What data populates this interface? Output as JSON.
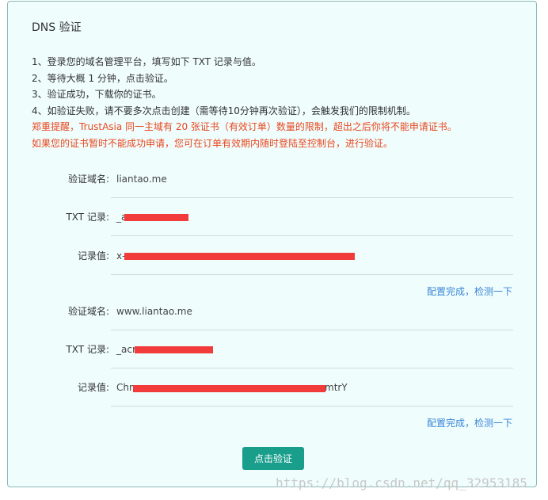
{
  "title": "DNS 验证",
  "instructions": [
    "1、登录您的域名管理平台，填写如下 TXT 记录与值。",
    "2、等待大概 1 分钟，点击验证。",
    "3、验证成功，下载你的证书。",
    "4、如验证失败，请不要多次点击创建（需等待10分钟再次验证），会触发我们的限制机制。"
  ],
  "warnings": [
    "郑重提醒，TrustAsia 同一主域有 20 张证书（有效订单）数量的限制，超出之后你将不能申请证书。",
    "如果您的证书暂时不能成功申请，您可在订单有效期内随时登陆至控制台，进行验证。"
  ],
  "labels": {
    "domain": "验证域名:",
    "txt": "TXT 记录:",
    "value": "记录值:"
  },
  "group1": {
    "domain": "liantao.me",
    "txt": "_a",
    "value": "x-"
  },
  "group2": {
    "domain": "www.liantao.me",
    "txt": "_acr",
    "value_start": "Chn",
    "value_end": "mtrY"
  },
  "check_link": "配置完成，检测一下",
  "verify_button": "点击验证",
  "watermark": "https://blog.csdn.net/qq_32953185",
  "colors": {
    "accent": "#199e8c",
    "warning": "#e8481f",
    "link": "#3a86d6",
    "redaction": "#f23b3b"
  }
}
